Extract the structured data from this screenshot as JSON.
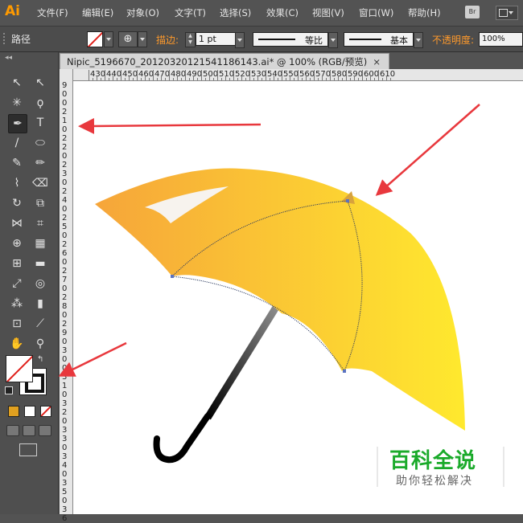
{
  "app": {
    "logo": "Ai",
    "bridge_label": "Br"
  },
  "menu": [
    "文件(F)",
    "编辑(E)",
    "对象(O)",
    "文字(T)",
    "选择(S)",
    "效果(C)",
    "视图(V)",
    "窗口(W)",
    "帮助(H)"
  ],
  "control": {
    "selection_label": "路径",
    "stroke_label": "描边:",
    "stroke_weight": "1 pt",
    "variable_width": "等比",
    "brush": "基本",
    "opacity_label": "不透明度:",
    "opacity_value": "100%",
    "style_icon": "⊕"
  },
  "document": {
    "tab_title": "Nipic_5196670_20120320121541186143.ai* @ 100% (RGB/预览)",
    "close": "×"
  },
  "ruler": {
    "h_labels": [
      "430",
      "440",
      "450",
      "460",
      "470",
      "480",
      "490",
      "500",
      "510",
      "520",
      "530",
      "540",
      "550",
      "560",
      "570",
      "580",
      "590",
      "600",
      "610"
    ],
    "v_labels": [
      "9",
      "0",
      "0",
      "2",
      "1",
      "0",
      "2",
      "2",
      "0",
      "2",
      "3",
      "0",
      "2",
      "4",
      "0",
      "2",
      "5",
      "0",
      "2",
      "6",
      "0",
      "2",
      "7",
      "0",
      "2",
      "8",
      "0",
      "2",
      "9",
      "0",
      "3",
      "0",
      "0",
      "3",
      "1",
      "0",
      "3",
      "2",
      "0",
      "3",
      "3",
      "0",
      "3",
      "4",
      "0",
      "3",
      "5",
      "0",
      "3",
      "6"
    ]
  },
  "tools": [
    {
      "name": "selection-tool",
      "glyph": "↖"
    },
    {
      "name": "direct-selection-tool",
      "glyph": "↖"
    },
    {
      "name": "magic-wand-tool",
      "glyph": "✳"
    },
    {
      "name": "lasso-tool",
      "glyph": "ϙ"
    },
    {
      "name": "pen-tool",
      "glyph": "✒"
    },
    {
      "name": "type-tool",
      "glyph": "T"
    },
    {
      "name": "line-segment-tool",
      "glyph": "/"
    },
    {
      "name": "ellipse-tool",
      "glyph": "⬭"
    },
    {
      "name": "paintbrush-tool",
      "glyph": "✎"
    },
    {
      "name": "pencil-tool",
      "glyph": "✏"
    },
    {
      "name": "blob-brush-tool",
      "glyph": "⌇"
    },
    {
      "name": "eraser-tool",
      "glyph": "⌫"
    },
    {
      "name": "rotate-tool",
      "glyph": "↻"
    },
    {
      "name": "scale-tool",
      "glyph": "⧉"
    },
    {
      "name": "width-tool",
      "glyph": "⋈"
    },
    {
      "name": "free-transform-tool",
      "glyph": "⌗"
    },
    {
      "name": "shape-builder-tool",
      "glyph": "⊕"
    },
    {
      "name": "perspective-grid-tool",
      "glyph": "▦"
    },
    {
      "name": "mesh-tool",
      "glyph": "⊞"
    },
    {
      "name": "gradient-tool",
      "glyph": "▬"
    },
    {
      "name": "eyedropper-tool",
      "glyph": "⤢"
    },
    {
      "name": "blend-tool",
      "glyph": "◎"
    },
    {
      "name": "symbol-sprayer-tool",
      "glyph": "⁂"
    },
    {
      "name": "column-graph-tool",
      "glyph": "▮"
    },
    {
      "name": "artboard-tool",
      "glyph": "⊡"
    },
    {
      "name": "slice-tool",
      "glyph": "⟋"
    },
    {
      "name": "hand-tool",
      "glyph": "✋"
    },
    {
      "name": "zoom-tool",
      "glyph": "⚲"
    }
  ],
  "colors": {
    "umbrella_start": "#f6a53a",
    "umbrella_end": "#ffe92e",
    "arrow": "#e8383d",
    "watermark": "#1aaa2a"
  },
  "watermark": {
    "title": "百科全说",
    "subtitle": "助你轻松解决"
  }
}
